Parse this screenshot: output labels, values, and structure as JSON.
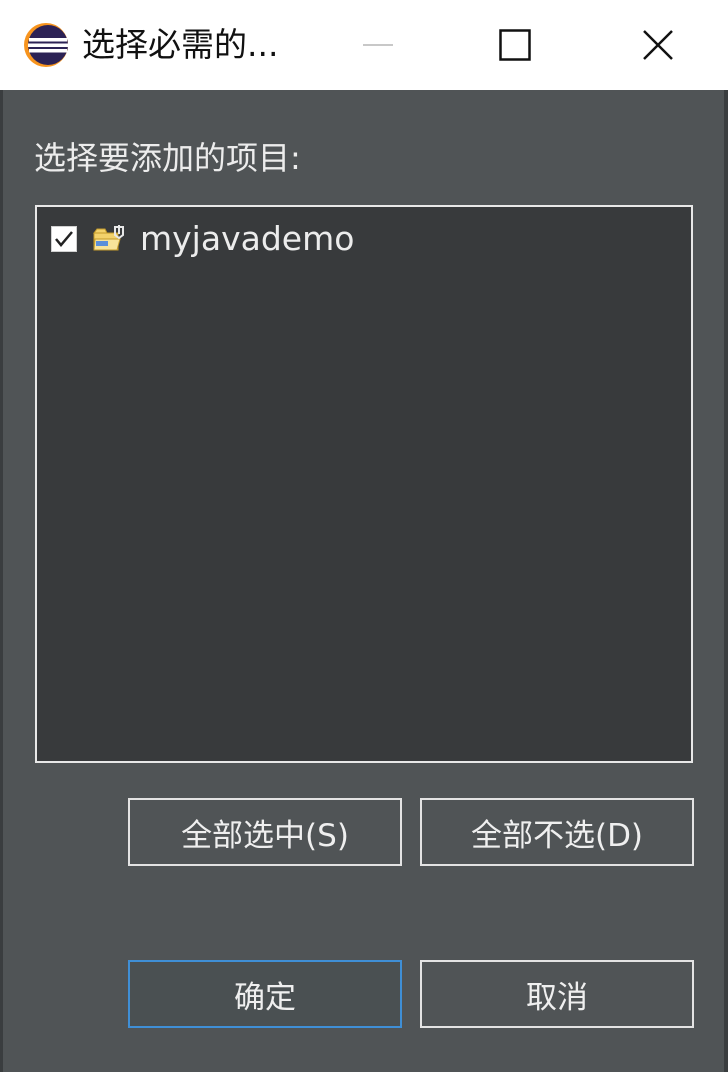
{
  "window": {
    "title": "选择必需的...",
    "app_icon": "eclipse-icon",
    "controls": {
      "minimize": "minimize-icon",
      "maximize": "maximize-icon",
      "close": "close-icon"
    }
  },
  "dialog": {
    "prompt": "选择要添加的项目:",
    "items": [
      {
        "label": "myjavademo",
        "checked": true,
        "icon": "java-project-folder-icon"
      }
    ],
    "buttons": {
      "select_all": "全部选中(S)",
      "deselect_all": "全部不选(D)",
      "ok": "确定",
      "cancel": "取消"
    }
  },
  "colors": {
    "dialog_background": "#505456",
    "list_background": "#383a3c",
    "titlebar_background": "#ffffff",
    "focus_border": "#3f8fd6",
    "text": "#ececec"
  }
}
